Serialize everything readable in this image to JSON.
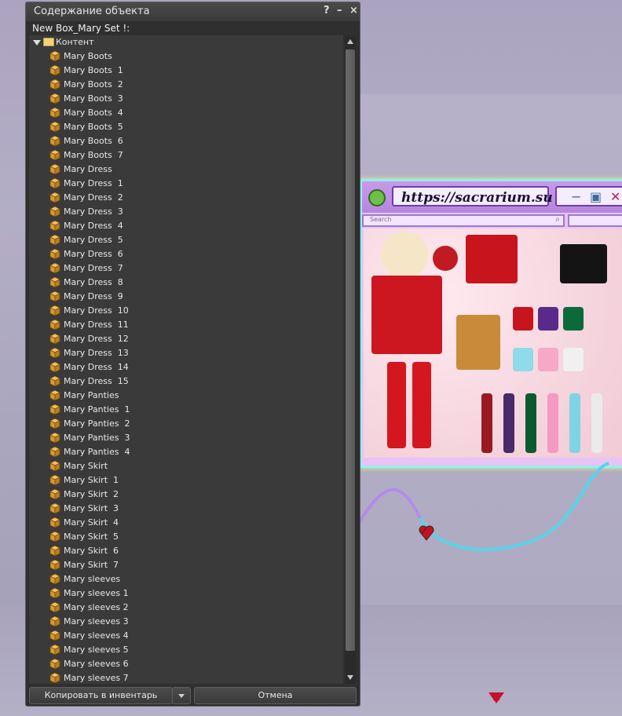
{
  "window": {
    "title": "Содержание объекта",
    "help_label": "?",
    "minimize_label": "–",
    "close_label": "×",
    "object_name": "New Box_Mary Set !:"
  },
  "tree": {
    "folder_label": "Контент",
    "items": [
      "Mary Boots",
      "Mary Boots  1",
      "Mary Boots  2",
      "Mary Boots  3",
      "Mary Boots  4",
      "Mary Boots  5",
      "Mary Boots  6",
      "Mary Boots  7",
      "Mary Dress",
      "Mary Dress  1",
      "Mary Dress  2",
      "Mary Dress  3",
      "Mary Dress  4",
      "Mary Dress  5",
      "Mary Dress  6",
      "Mary Dress  7",
      "Mary Dress  8",
      "Mary Dress  9",
      "Mary Dress  10",
      "Mary Dress  11",
      "Mary Dress  12",
      "Mary Dress  13",
      "Mary Dress  14",
      "Mary Dress  15",
      "Mary Panties",
      "Mary Panties  1",
      "Mary Panties  2",
      "Mary Panties  3",
      "Mary Panties  4",
      "Mary Skirt",
      "Mary Skirt  1",
      "Mary Skirt  2",
      "Mary Skirt  3",
      "Mary Skirt  4",
      "Mary Skirt  5",
      "Mary Skirt  6",
      "Mary Skirt  7",
      "Mary sleeves",
      "Mary sleeves 1",
      "Mary sleeves 2",
      "Mary sleeves 3",
      "Mary sleeves 4",
      "Mary sleeves 5",
      "Mary sleeves 6",
      "Mary sleeves 7"
    ]
  },
  "buttons": {
    "copy_label": "Копировать в инвентарь",
    "cancel_label": "Отмена"
  },
  "scene": {
    "board_url": "https://sacrarium.su",
    "board_search": "Search"
  },
  "colors": {
    "window_bg": "#2f2f2f",
    "list_bg": "#3a3a3a",
    "text": "#e8e8e8",
    "box_icon": "#d89a2c"
  },
  "icons": {
    "item": "box-icon",
    "folder": "folder-icon",
    "expand": "triangle-down-icon"
  }
}
